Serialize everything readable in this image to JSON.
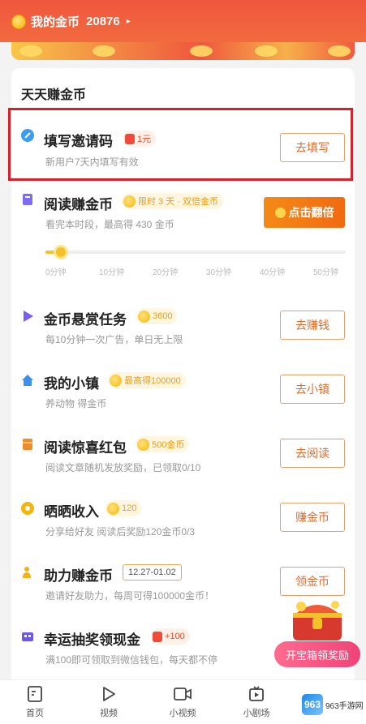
{
  "header": {
    "coins_label": "我的金币",
    "coins_value": "20876",
    "arrow": "▸"
  },
  "section_title": "天天赚金币",
  "tasks": [
    {
      "icon": "invite-code-icon",
      "title": "填写邀请码",
      "badge": "1元",
      "subtitle": "新用户7天内填写有效",
      "button": "去填写"
    },
    {
      "icon": "book-icon",
      "title": "阅读赚金币",
      "badge": "限时 3 天 · 双倍金币",
      "subtitle": "看完本时段，最高得 430 金币",
      "button": "点击翻倍"
    },
    {
      "icon": "play-icon",
      "title": "金币悬赏任务",
      "badge": "3600",
      "subtitle": "每10分钟一次广告，单日无上限",
      "button": "去赚钱"
    },
    {
      "icon": "house-icon",
      "title": "我的小镇",
      "badge": "最高得100000",
      "subtitle": "养动物 得金币",
      "button": "去小镇"
    },
    {
      "icon": "red-packet-icon",
      "title": "阅读惊喜红包",
      "badge": "500金币",
      "subtitle": "阅读文章随机发放奖励，已领取0/10",
      "button": "去阅读"
    },
    {
      "icon": "share-icon",
      "title": "晒晒收入",
      "badge": "120",
      "subtitle": "分享给好友 阅读后奖励120金币0/3",
      "button": "赚金币"
    },
    {
      "icon": "helper-icon",
      "title": "助力赚金币",
      "badge": "12.27-01.02",
      "subtitle": "邀请好友助力，每周可得100000金币！",
      "button": "领金币"
    },
    {
      "icon": "lottery-icon",
      "title": "幸运抽奖领现金",
      "badge": "+100",
      "subtitle": "满100即可领取到微信钱包，每天都不停",
      "button": "开宝箱领奖励"
    }
  ],
  "reading_progress": {
    "fraction": 0.05,
    "ticks": [
      "0分钟",
      "10分钟",
      "20分钟",
      "30分钟",
      "40分钟",
      "50分钟"
    ]
  },
  "tabbar": [
    {
      "icon": "home-icon",
      "label": "首页"
    },
    {
      "icon": "video-icon",
      "label": "视频"
    },
    {
      "icon": "short-video-icon",
      "label": "小视频"
    },
    {
      "icon": "mini-drama-icon",
      "label": "小剧场"
    }
  ],
  "watermark": {
    "logo": "963",
    "text": "963手游网"
  },
  "colors": {
    "header": "#f0573d",
    "accent": "#f26a12",
    "highlight_border": "#d9202a",
    "gold": "#f5c12b"
  }
}
